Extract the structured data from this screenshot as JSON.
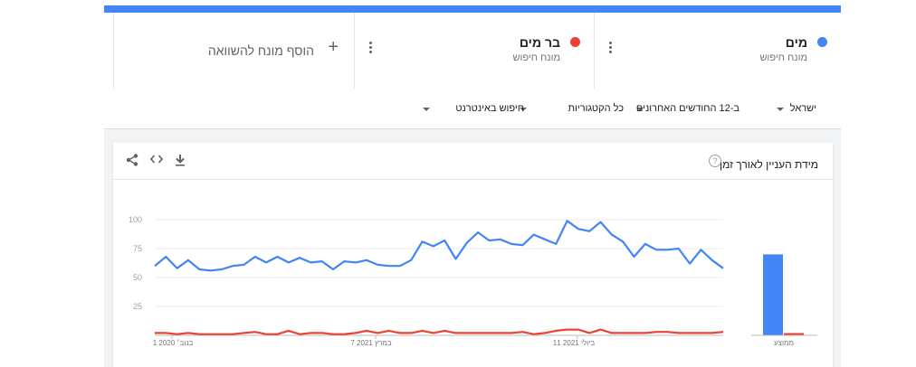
{
  "terms": [
    {
      "name": "מים",
      "sub": "מונח חיפוש",
      "color": "#4285f4"
    },
    {
      "name": "בר מים",
      "sub": "מונח חיפוש",
      "color": "#ea4335"
    }
  ],
  "add_compare": {
    "label": "הוסף מונח להשוואה",
    "icon": "plus-icon"
  },
  "filters": {
    "region": "ישראל",
    "period": "ב-12 החודשים האחרונים",
    "category": "כל הקטגוריות",
    "search_type": "חיפוש באינטרנט"
  },
  "card": {
    "title": "מידת העניין לאורך זמן",
    "help": "?",
    "tools": [
      "download-icon",
      "embed-icon",
      "share-icon"
    ]
  },
  "chart_data": {
    "type": "line",
    "ylim": [
      0,
      100
    ],
    "yticks": [
      25,
      50,
      75,
      100
    ],
    "xtick_labels": [
      "1 בנוב׳ 2020",
      "7 במרץ 2021",
      "11 ביולי 2021"
    ],
    "series": [
      {
        "name": "מים",
        "color": "#4285f4",
        "values": [
          60,
          68,
          58,
          65,
          57,
          56,
          57,
          60,
          61,
          68,
          63,
          68,
          63,
          67,
          63,
          64,
          57,
          64,
          63,
          65,
          61,
          60,
          60,
          65,
          81,
          77,
          82,
          66,
          80,
          89,
          82,
          83,
          79,
          78,
          87,
          83,
          79,
          99,
          92,
          90,
          98,
          87,
          81,
          68,
          79,
          74,
          74,
          75,
          62,
          74,
          65,
          58
        ]
      },
      {
        "name": "בר מים",
        "color": "#ea4335",
        "values": [
          2,
          2,
          1,
          2,
          1,
          1,
          1,
          1,
          2,
          3,
          1,
          1,
          4,
          1,
          2,
          2,
          1,
          1,
          2,
          4,
          2,
          4,
          2,
          2,
          4,
          2,
          4,
          2,
          2,
          2,
          2,
          2,
          2,
          3,
          1,
          2,
          4,
          5,
          5,
          2,
          5,
          2,
          2,
          2,
          2,
          3,
          3,
          2,
          2,
          2,
          2,
          3
        ]
      }
    ],
    "average": {
      "label": "ממוצע",
      "values": [
        70,
        2
      ]
    }
  }
}
